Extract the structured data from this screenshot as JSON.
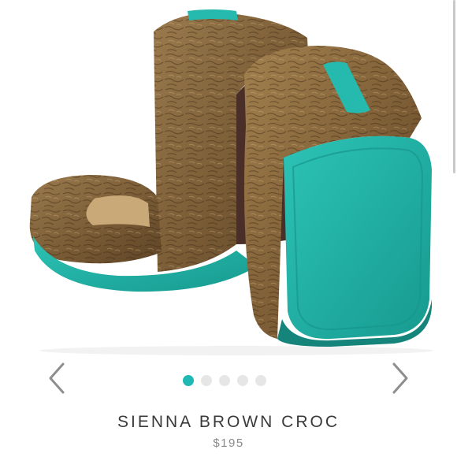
{
  "product": {
    "name": "SIENNA BROWN CROC",
    "price": "$195"
  },
  "carousel": {
    "slide_count": 5,
    "active_index": 0,
    "prev_icon": "chevron-left-icon",
    "next_icon": "chevron-right-icon"
  },
  "colors": {
    "accent": "#1fb8b4",
    "dot_inactive": "#e6e6e6",
    "leather": "#8a6a42",
    "sole": "#22b3a5"
  }
}
